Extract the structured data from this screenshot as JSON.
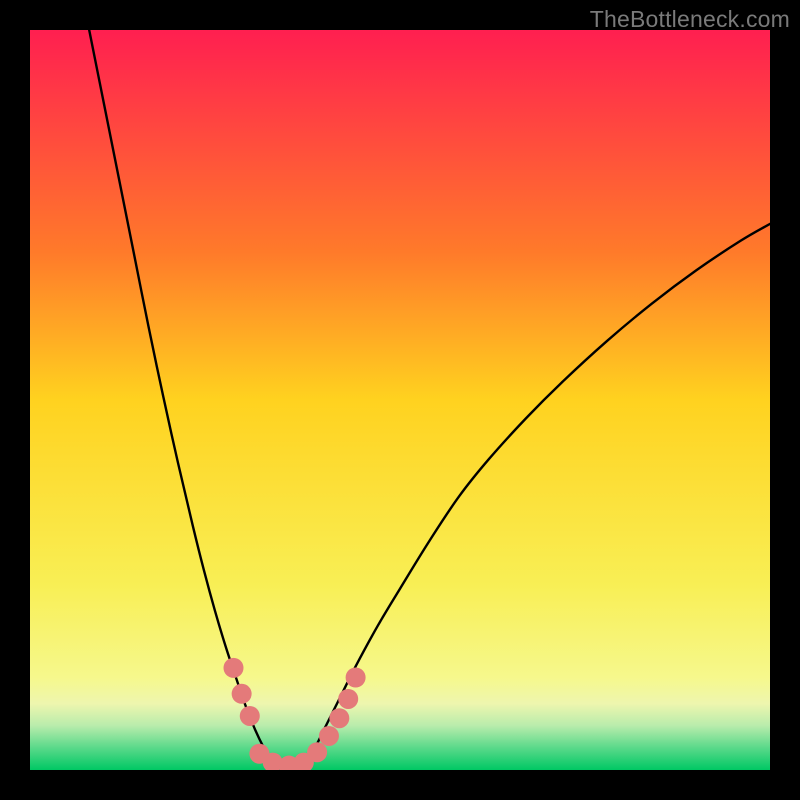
{
  "watermark": "TheBottleneck.com",
  "chart_data": {
    "type": "line",
    "title": "",
    "xlabel": "",
    "ylabel": "",
    "xlim": [
      0,
      100
    ],
    "ylim": [
      0,
      100
    ],
    "background_gradient": {
      "stops": [
        {
          "y": 100,
          "color": "#ff1f50"
        },
        {
          "y": 70,
          "color": "#ff7a2a"
        },
        {
          "y": 50,
          "color": "#ffd21f"
        },
        {
          "y": 25,
          "color": "#f8ef55"
        },
        {
          "y": 12.5,
          "color": "#f6f88c"
        },
        {
          "y": 9,
          "color": "#eef6ae"
        },
        {
          "y": 6,
          "color": "#b9ecac"
        },
        {
          "y": 3,
          "color": "#5ad98a"
        },
        {
          "y": 0,
          "color": "#00c864"
        }
      ]
    },
    "series": [
      {
        "name": "left-branch",
        "type": "line",
        "x": [
          8,
          10,
          12,
          14,
          16,
          18,
          20,
          22,
          23.5,
          25,
          26.5,
          28,
          29.2,
          30.4,
          31.6,
          33
        ],
        "y": [
          100,
          90,
          80,
          70,
          60,
          50.5,
          41.5,
          33,
          27,
          21.5,
          16.5,
          12,
          8.5,
          5.5,
          3,
          0.6
        ]
      },
      {
        "name": "right-branch",
        "type": "line",
        "x": [
          37,
          38.5,
          40,
          42,
          44,
          47,
          50,
          54,
          58,
          62,
          67,
          72,
          78,
          84,
          90,
          96,
          100
        ],
        "y": [
          0.6,
          3,
          6,
          10,
          14,
          19.5,
          24.5,
          31,
          37,
          42,
          47.5,
          52.5,
          58,
          63,
          67.5,
          71.5,
          73.8
        ]
      },
      {
        "name": "markers-left",
        "type": "scatter",
        "color": "#e47a7a",
        "radius": 10,
        "points": [
          {
            "x": 27.5,
            "y": 13.8
          },
          {
            "x": 28.6,
            "y": 10.3
          },
          {
            "x": 29.7,
            "y": 7.3
          }
        ]
      },
      {
        "name": "markers-bottom",
        "type": "scatter",
        "color": "#e47a7a",
        "radius": 10,
        "points": [
          {
            "x": 31.0,
            "y": 2.2
          },
          {
            "x": 32.8,
            "y": 1.0
          },
          {
            "x": 35.0,
            "y": 0.6
          },
          {
            "x": 37.0,
            "y": 1.0
          },
          {
            "x": 38.8,
            "y": 2.4
          },
          {
            "x": 40.4,
            "y": 4.6
          },
          {
            "x": 41.8,
            "y": 7.0
          },
          {
            "x": 43.0,
            "y": 9.6
          }
        ]
      },
      {
        "name": "markers-right",
        "type": "scatter",
        "color": "#e47a7a",
        "radius": 10,
        "points": [
          {
            "x": 44.0,
            "y": 12.5
          }
        ]
      }
    ]
  }
}
